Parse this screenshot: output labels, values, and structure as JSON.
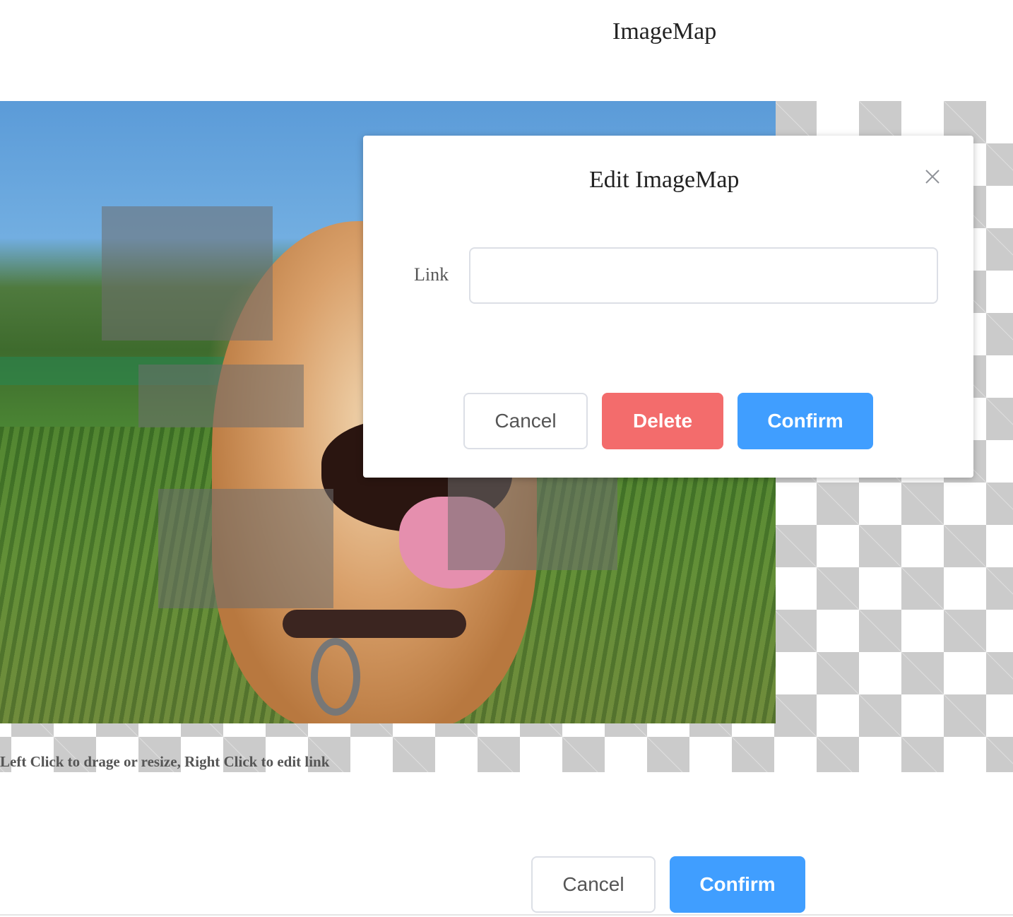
{
  "page": {
    "title": "ImageMap",
    "hint": "Left Click to drage or resize, Right Click to edit link"
  },
  "modal": {
    "title": "Edit ImageMap",
    "link_label": "Link",
    "link_value": "",
    "cancel_label": "Cancel",
    "delete_label": "Delete",
    "confirm_label": "Confirm",
    "close_icon": "close-icon"
  },
  "footer": {
    "cancel_label": "Cancel",
    "confirm_label": "Confirm"
  },
  "colors": {
    "primary": "#409eff",
    "danger": "#f36c6c",
    "checker": "#cbcbcb",
    "area_overlay": "rgba(110,110,110,0.55)"
  }
}
